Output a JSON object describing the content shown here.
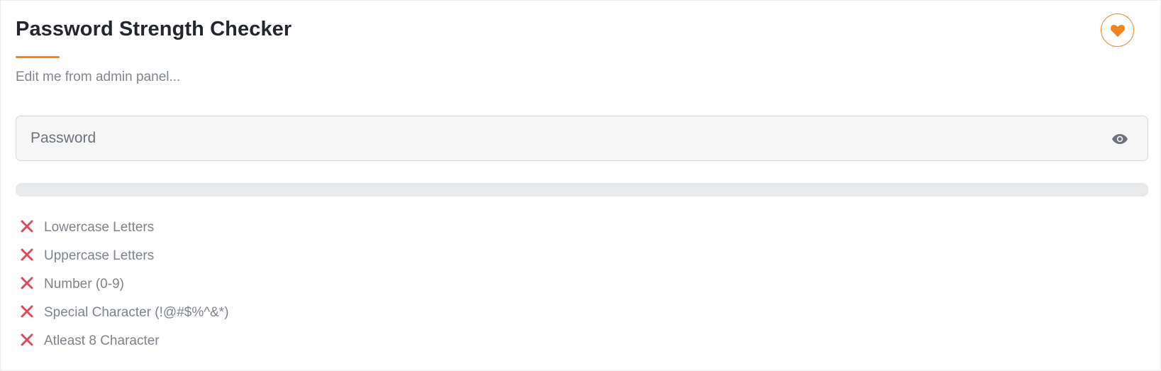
{
  "header": {
    "title": "Password Strength Checker",
    "subtitle": "Edit me from admin panel...",
    "favorite_icon": "heart-icon"
  },
  "password": {
    "placeholder": "Password",
    "value": "",
    "toggle_icon": "eye-icon"
  },
  "strength": {
    "level_fraction": 0
  },
  "requirements": [
    {
      "label": "Lowercase Letters",
      "met": false,
      "icon": "x-icon"
    },
    {
      "label": "Uppercase Letters",
      "met": false,
      "icon": "x-icon"
    },
    {
      "label": "Number (0-9)",
      "met": false,
      "icon": "x-icon"
    },
    {
      "label": "Special Character (!@#$%^&*)",
      "met": false,
      "icon": "x-icon"
    },
    {
      "label": "Atleast 8 Character",
      "met": false,
      "icon": "x-icon"
    }
  ],
  "colors": {
    "accent": "#f0851e",
    "fail": "#dc3545",
    "bar_track": "#e8e9eb",
    "muted_text": "#7d838b"
  }
}
